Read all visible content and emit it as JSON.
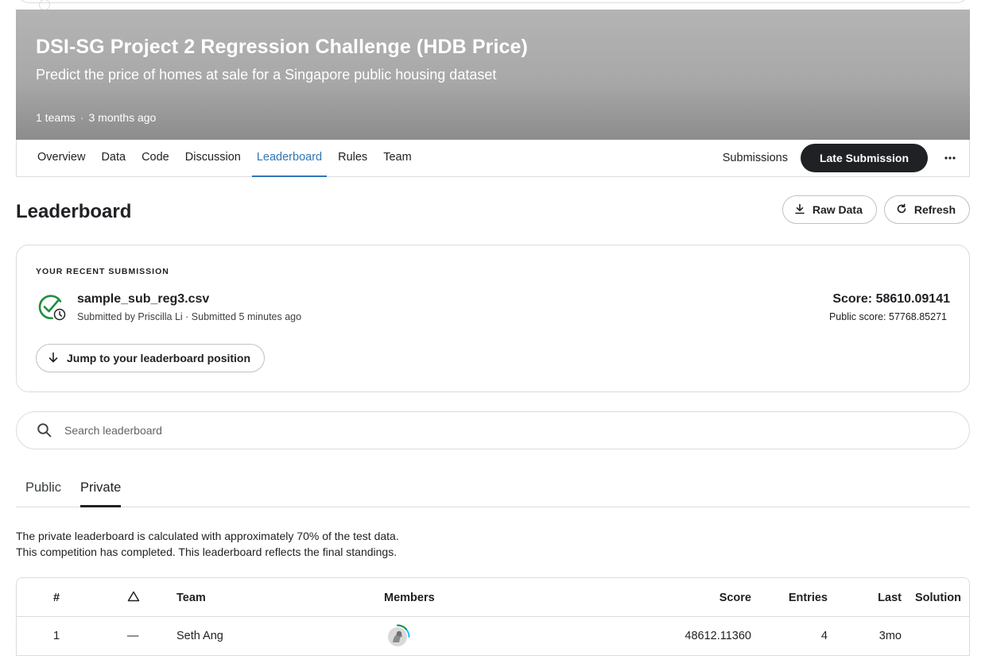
{
  "competition": {
    "title": "DSI-SG Project 2 Regression Challenge (HDB Price)",
    "subtitle": "Predict the price of homes at sale for a Singapore public housing dataset",
    "teams": "1 teams",
    "separator": "·",
    "age": "3 months ago"
  },
  "nav": {
    "tabs": [
      {
        "label": "Overview"
      },
      {
        "label": "Data"
      },
      {
        "label": "Code"
      },
      {
        "label": "Discussion"
      },
      {
        "label": "Leaderboard",
        "active": true
      },
      {
        "label": "Rules"
      },
      {
        "label": "Team"
      }
    ],
    "submissions": "Submissions",
    "late_submission": "Late Submission",
    "more_icon": "more-horizontal-icon"
  },
  "leaderboard": {
    "title": "Leaderboard",
    "raw_data": "Raw Data",
    "refresh": "Refresh"
  },
  "recent": {
    "label": "YOUR RECENT SUBMISSION",
    "file": "sample_sub_reg3.csv",
    "meta": "Submitted by Priscilla Li · Submitted 5 minutes ago",
    "score": "Score: 58610.09141",
    "public_score": "Public score: 57768.85271",
    "jump": "Jump to your leaderboard position",
    "status_icon": "check-circle-clock-icon"
  },
  "search": {
    "placeholder": "Search leaderboard"
  },
  "board_tabs": {
    "public": "Public",
    "private": "Private",
    "active": "private"
  },
  "notes": {
    "line1": "The private leaderboard is calculated with approximately 70% of the test data.",
    "line2": "This competition has completed. This leaderboard reflects the final standings."
  },
  "table": {
    "headers": {
      "rank": "#",
      "team": "Team",
      "members": "Members",
      "score": "Score",
      "entries": "Entries",
      "last": "Last",
      "solution": "Solution"
    },
    "rows": [
      {
        "rank": "1",
        "delta": "—",
        "team": "Seth Ang",
        "score": "48612.11360",
        "entries": "4",
        "last": "3mo",
        "solution": ""
      }
    ]
  },
  "colors": {
    "accent_blue": "#2f76b8",
    "success_green": "#1e8e3e",
    "dark": "#202124"
  }
}
